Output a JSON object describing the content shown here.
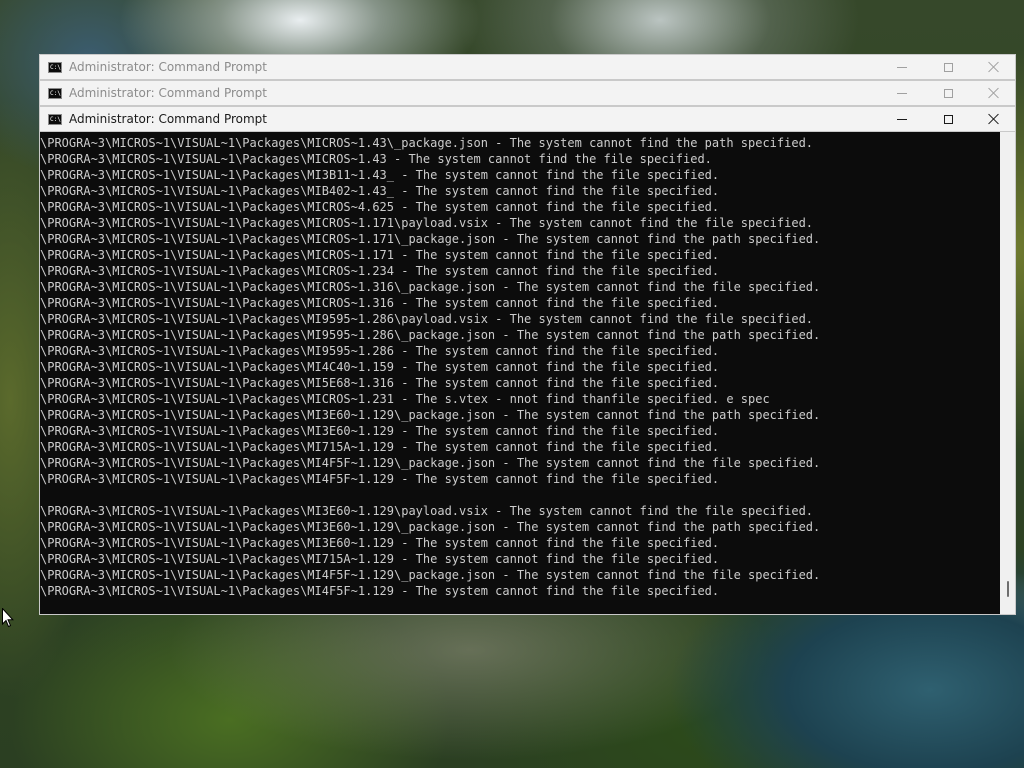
{
  "windows": [
    {
      "title": "Administrator:  Command Prompt",
      "active": false
    },
    {
      "title": "Administrator:  Command Prompt",
      "active": false
    },
    {
      "title": "Administrator:  Command Prompt",
      "active": true
    }
  ],
  "icons": {
    "window_icon": "cmd-icon",
    "minimize": "minimize-icon",
    "maximize": "maximize-icon",
    "close": "close-icon",
    "pointer": "mouse-pointer-icon"
  },
  "colors": {
    "console_bg": "#0c0c0c",
    "console_text": "#cccccc",
    "titlebar_bg": "#f3f3f3"
  },
  "console": {
    "lines": [
      "\\PROGRA~3\\MICROS~1\\VISUAL~1\\Packages\\MICROS~1.43\\_package.json - The system cannot find the path specified.",
      "\\PROGRA~3\\MICROS~1\\VISUAL~1\\Packages\\MICROS~1.43 - The system cannot find the file specified.",
      "\\PROGRA~3\\MICROS~1\\VISUAL~1\\Packages\\MI3B11~1.43_ - The system cannot find the file specified.",
      "\\PROGRA~3\\MICROS~1\\VISUAL~1\\Packages\\MIB402~1.43_ - The system cannot find the file specified.",
      "\\PROGRA~3\\MICROS~1\\VISUAL~1\\Packages\\MICROS~4.625 - The system cannot find the file specified.",
      "\\PROGRA~3\\MICROS~1\\VISUAL~1\\Packages\\MICROS~1.171\\payload.vsix - The system cannot find the file specified.",
      "\\PROGRA~3\\MICROS~1\\VISUAL~1\\Packages\\MICROS~1.171\\_package.json - The system cannot find the path specified.",
      "\\PROGRA~3\\MICROS~1\\VISUAL~1\\Packages\\MICROS~1.171 - The system cannot find the file specified.",
      "\\PROGRA~3\\MICROS~1\\VISUAL~1\\Packages\\MICROS~1.234 - The system cannot find the file specified.",
      "\\PROGRA~3\\MICROS~1\\VISUAL~1\\Packages\\MICROS~1.316\\_package.json - The system cannot find the file specified.",
      "\\PROGRA~3\\MICROS~1\\VISUAL~1\\Packages\\MICROS~1.316 - The system cannot find the file specified.",
      "\\PROGRA~3\\MICROS~1\\VISUAL~1\\Packages\\MI9595~1.286\\payload.vsix - The system cannot find the file specified.",
      "\\PROGRA~3\\MICROS~1\\VISUAL~1\\Packages\\MI9595~1.286\\_package.json - The system cannot find the path specified.",
      "\\PROGRA~3\\MICROS~1\\VISUAL~1\\Packages\\MI9595~1.286 - The system cannot find the file specified.",
      "\\PROGRA~3\\MICROS~1\\VISUAL~1\\Packages\\MI4C40~1.159 - The system cannot find the file specified.",
      "\\PROGRA~3\\MICROS~1\\VISUAL~1\\Packages\\MI5E68~1.316 - The system cannot find the file specified.",
      "\\PROGRA~3\\MICROS~1\\VISUAL~1\\Packages\\MICROS~1.231 - The s.vtex - nnot find thanfile specified. e spec",
      "\\PROGRA~3\\MICROS~1\\VISUAL~1\\Packages\\MI3E60~1.129\\_package.json - The system cannot find the path specified.",
      "\\PROGRA~3\\MICROS~1\\VISUAL~1\\Packages\\MI3E60~1.129 - The system cannot find the file specified.",
      "\\PROGRA~3\\MICROS~1\\VISUAL~1\\Packages\\MI715A~1.129 - The system cannot find the file specified.",
      "\\PROGRA~3\\MICROS~1\\VISUAL~1\\Packages\\MI4F5F~1.129\\_package.json - The system cannot find the file specified.",
      "\\PROGRA~3\\MICROS~1\\VISUAL~1\\Packages\\MI4F5F~1.129 - The system cannot find the file specified.",
      "",
      "\\PROGRA~3\\MICROS~1\\VISUAL~1\\Packages\\MI3E60~1.129\\payload.vsix - The system cannot find the file specified.",
      "\\PROGRA~3\\MICROS~1\\VISUAL~1\\Packages\\MI3E60~1.129\\_package.json - The system cannot find the path specified.",
      "\\PROGRA~3\\MICROS~1\\VISUAL~1\\Packages\\MI3E60~1.129 - The system cannot find the file specified.",
      "\\PROGRA~3\\MICROS~1\\VISUAL~1\\Packages\\MI715A~1.129 - The system cannot find the file specified.",
      "\\PROGRA~3\\MICROS~1\\VISUAL~1\\Packages\\MI4F5F~1.129\\_package.json - The system cannot find the file specified.",
      "\\PROGRA~3\\MICROS~1\\VISUAL~1\\Packages\\MI4F5F~1.129 - The system cannot find the file specified."
    ]
  }
}
